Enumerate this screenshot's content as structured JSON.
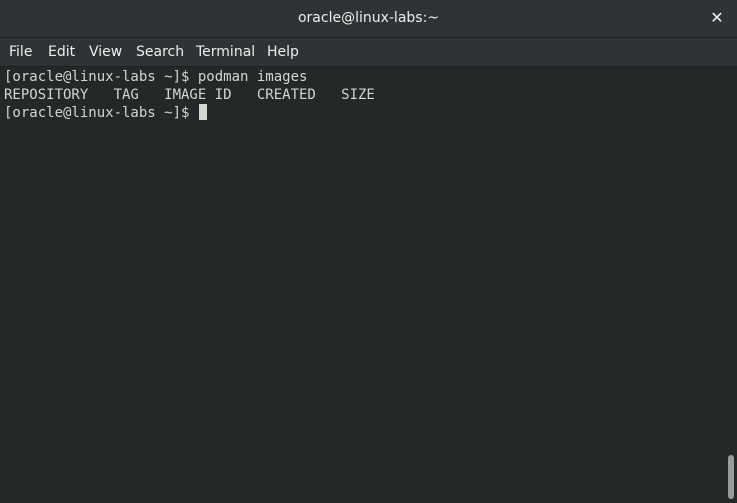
{
  "window": {
    "title": "oracle@linux-labs:~",
    "close_glyph": "✕"
  },
  "menubar": {
    "items": [
      "File",
      "Edit",
      "View",
      "Search",
      "Terminal",
      "Help"
    ]
  },
  "terminal": {
    "lines": [
      "[oracle@linux-labs ~]$ podman images",
      "REPOSITORY   TAG   IMAGE ID   CREATED   SIZE",
      "[oracle@linux-labs ~]$ "
    ]
  },
  "colors": {
    "background": "#232829",
    "text": "#d3d7cf",
    "chrome": "#2e3436"
  }
}
